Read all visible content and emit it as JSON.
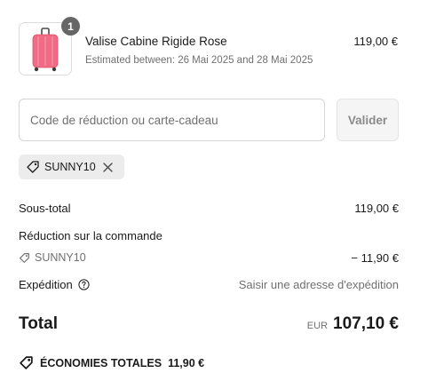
{
  "product": {
    "quantity_badge": "1",
    "title": "Valise Cabine Rigide Rose",
    "subtitle": "Estimated between: 26 Mai 2025 and 28 Mai 2025",
    "price": "119,00 €",
    "image_icon": "pink-suitcase-image",
    "accent_color": "#f06b86"
  },
  "discount": {
    "placeholder": "Code de réduction ou carte-cadeau",
    "value": "",
    "button_label": "Valider",
    "applied_code": "SUNNY10"
  },
  "summary": {
    "subtotal_label": "Sous-total",
    "subtotal_value": "119,00 €",
    "order_discount_label": "Réduction sur la commande",
    "order_discount_code": "SUNNY10",
    "order_discount_value": "− 11,90 €",
    "shipping_label": "Expédition",
    "shipping_value": "Saisir une adresse d'expédition",
    "total_label": "Total",
    "total_currency": "EUR",
    "total_value": "107,10 €",
    "savings_label": "ÉCONOMIES TOTALES",
    "savings_value": "11,90 €"
  }
}
